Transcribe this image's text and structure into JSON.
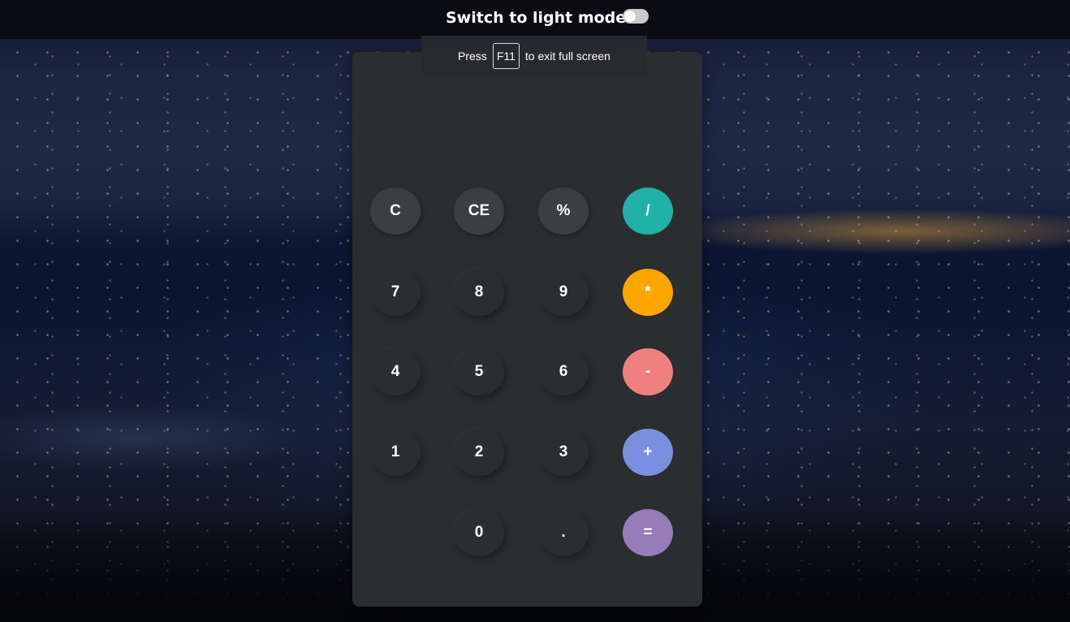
{
  "topbar": {
    "theme_toggle_label": "Switch to light mode",
    "theme_toggle_state": "off"
  },
  "fullscreen_notice": {
    "prefix": "Press",
    "key": "F11",
    "suffix": "to exit full screen"
  },
  "calculator": {
    "display_value": "",
    "keys": {
      "clear": "C",
      "clear_entry": "CE",
      "percent": "%",
      "divide": "/",
      "seven": "7",
      "eight": "8",
      "nine": "9",
      "multiply": "*",
      "four": "4",
      "five": "5",
      "six": "6",
      "subtract": "-",
      "one": "1",
      "two": "2",
      "three": "3",
      "add": "+",
      "zero": "0",
      "decimal": ".",
      "equals": "="
    },
    "colors": {
      "panel": "#2b2e30",
      "function_key": "#3c3f42",
      "divide": "#22b1a8",
      "multiply": "#ffa500",
      "subtract": "#f07f7f",
      "add": "#7b8fdf",
      "equals": "#977cba"
    }
  }
}
